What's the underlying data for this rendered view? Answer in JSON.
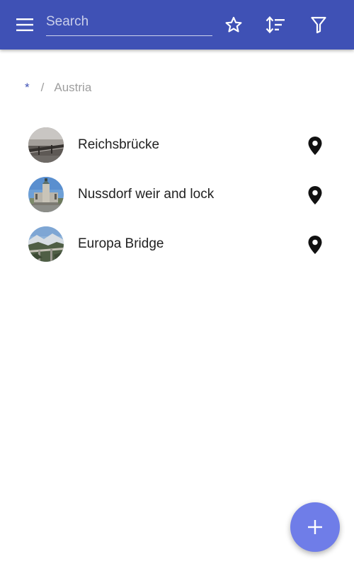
{
  "appbar": {
    "menu_icon": "menu-icon",
    "search_placeholder": "Search",
    "search_value": "",
    "actions": [
      "star-outline-icon",
      "sort-icon",
      "filter-icon"
    ],
    "color": "#3f51b5"
  },
  "breadcrumb": {
    "root": "*",
    "separator": "/",
    "current": "Austria"
  },
  "list": {
    "items": [
      {
        "label": "Reichsbrücke",
        "action_icon": "map-pin-icon"
      },
      {
        "label": "Nussdorf weir and lock",
        "action_icon": "map-pin-icon"
      },
      {
        "label": "Europa Bridge",
        "action_icon": "map-pin-icon"
      }
    ]
  },
  "fab": {
    "icon": "plus-icon",
    "color": "#6f7de8"
  }
}
